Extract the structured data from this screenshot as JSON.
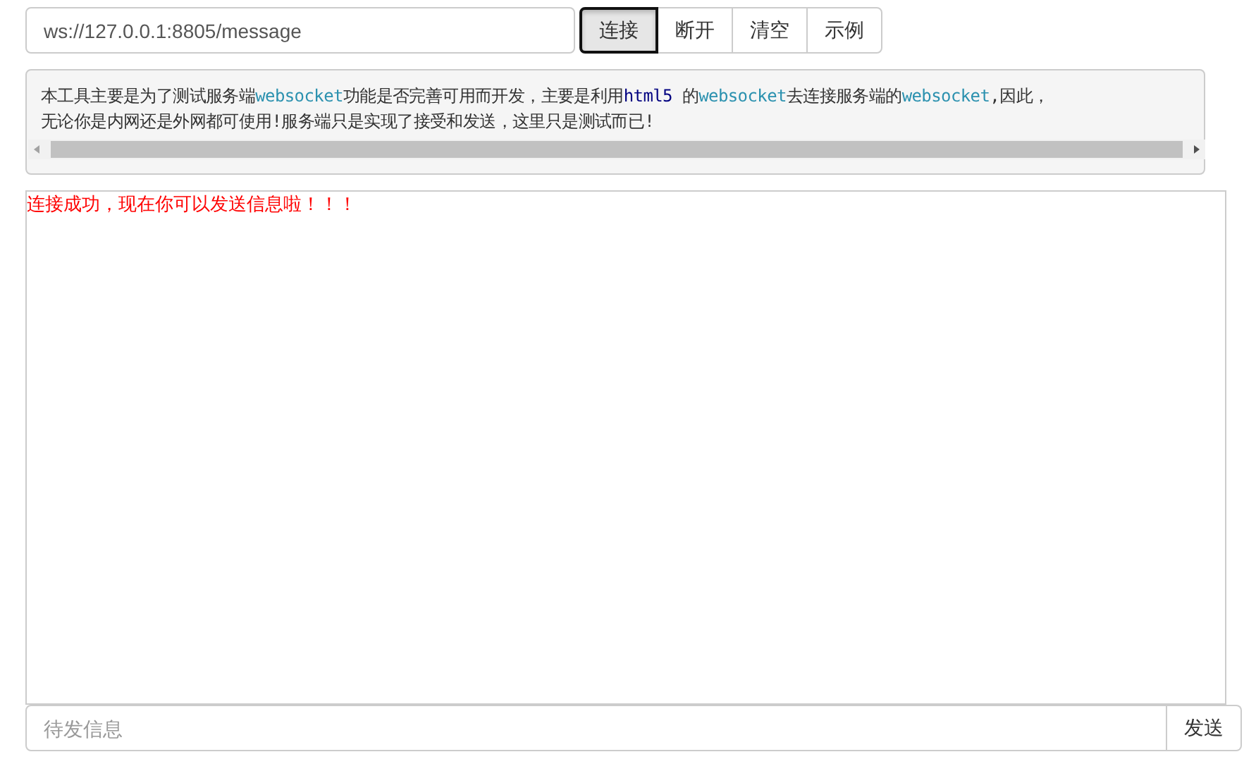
{
  "url_field": {
    "value": "ws://127.0.0.1:8805/message"
  },
  "buttons": [
    {
      "label": "连接",
      "selected": true
    },
    {
      "label": "断开",
      "selected": false
    },
    {
      "label": "清空",
      "selected": false
    },
    {
      "label": "示例",
      "selected": false
    }
  ],
  "info": {
    "lines": [
      [
        {
          "kind": "text",
          "text": "本工具主要是为了测试服务端"
        },
        {
          "kind": "code",
          "text": "websocket"
        },
        {
          "kind": "text",
          "text": "功能是否完善可用而开发，主要是利用"
        },
        {
          "kind": "keyword",
          "text": "html5"
        },
        {
          "kind": "text",
          "text": " 的"
        },
        {
          "kind": "code",
          "text": "websocket"
        },
        {
          "kind": "text",
          "text": "去连接服务端的"
        },
        {
          "kind": "code",
          "text": "websocket"
        },
        {
          "kind": "text",
          "text": ",因此，"
        }
      ],
      [
        {
          "kind": "text",
          "text": "无论你是内网还是外网都可使用!服务端只是实现了接受和发送，这里只是测试而已!"
        }
      ]
    ]
  },
  "log": [
    {
      "text": "连接成功，现在你可以发送信息啦！！！",
      "color": "#ff0000"
    }
  ],
  "message_field": {
    "placeholder": "待发信息"
  },
  "send_button": {
    "label": "发送"
  }
}
